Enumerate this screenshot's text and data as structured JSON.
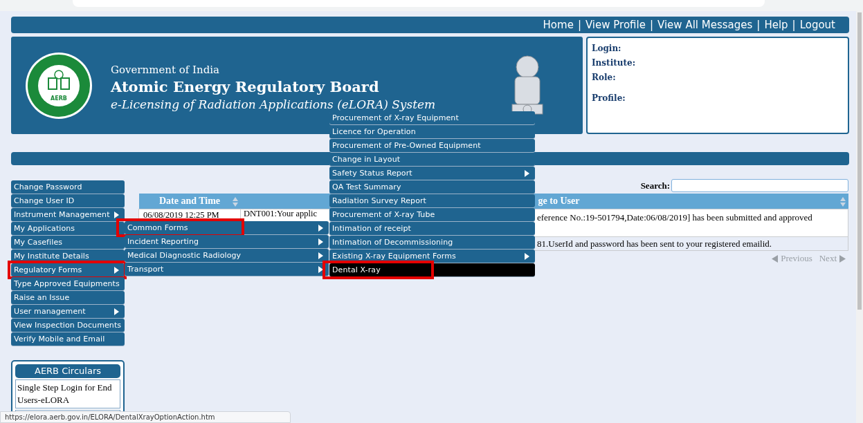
{
  "top_nav": {
    "links": [
      "Home",
      "View Profile",
      "View All Messages",
      "Help",
      "Logout"
    ],
    "separator": "|"
  },
  "banner": {
    "logo_text": "AERB",
    "line_1": "Government of India",
    "line_2": "Atomic Energy Regulatory Board",
    "line_3": "e-Licensing of Radiation Applications (eLORA) System"
  },
  "user_box": {
    "fields": [
      "Login:",
      "Institute:",
      "Role:",
      "Profile:"
    ]
  },
  "sidebar": {
    "items": [
      {
        "label": "Change Password",
        "has_submenu": false,
        "selected": false,
        "annotated": false
      },
      {
        "label": "Change User ID",
        "has_submenu": false,
        "selected": false,
        "annotated": false
      },
      {
        "label": "Instrument Management",
        "has_submenu": true,
        "selected": false,
        "annotated": false
      },
      {
        "label": "My Applications",
        "has_submenu": false,
        "selected": false,
        "annotated": false
      },
      {
        "label": "My Casefiles",
        "has_submenu": false,
        "selected": false,
        "annotated": false
      },
      {
        "label": "My Institute Details",
        "has_submenu": false,
        "selected": false,
        "annotated": false
      },
      {
        "label": "Regulatory Forms",
        "has_submenu": true,
        "selected": false,
        "annotated": true
      },
      {
        "label": "Type Approved Equipments",
        "has_submenu": false,
        "selected": false,
        "annotated": false
      },
      {
        "label": "Raise an Issue",
        "has_submenu": false,
        "selected": false,
        "annotated": false
      },
      {
        "label": "User management",
        "has_submenu": true,
        "selected": false,
        "annotated": false
      },
      {
        "label": "View Inspection Documents",
        "has_submenu": false,
        "selected": false,
        "annotated": false
      },
      {
        "label": "Verify Mobile and Email",
        "has_submenu": false,
        "selected": false,
        "annotated": false
      }
    ]
  },
  "submenu": {
    "items": [
      {
        "label": "Common Forms",
        "has_submenu": true,
        "selected": false,
        "annotated": true
      },
      {
        "label": "Incident Reporting",
        "has_submenu": true,
        "selected": false,
        "annotated": false
      },
      {
        "label": "Medical Diagnostic Radiology",
        "has_submenu": true,
        "selected": false,
        "annotated": false
      },
      {
        "label": "Transport",
        "has_submenu": true,
        "selected": false,
        "annotated": false
      }
    ]
  },
  "common_forms_menu": {
    "items": [
      {
        "label": "Procurement of X-ray Equipment",
        "has_submenu": false,
        "selected": false,
        "annotated": false
      },
      {
        "label": "Licence for Operation",
        "has_submenu": false,
        "selected": false,
        "annotated": false
      },
      {
        "label": "Procurement of Pre-Owned Equipment",
        "has_submenu": false,
        "selected": false,
        "annotated": false
      },
      {
        "label": "Change in Layout",
        "has_submenu": false,
        "selected": false,
        "annotated": false
      },
      {
        "label": "Safety Status Report",
        "has_submenu": true,
        "selected": false,
        "annotated": false
      },
      {
        "label": "QA Test Summary",
        "has_submenu": false,
        "selected": false,
        "annotated": false
      },
      {
        "label": "Radiation Survey Report",
        "has_submenu": false,
        "selected": false,
        "annotated": false
      },
      {
        "label": "Procurement of X-ray Tube",
        "has_submenu": false,
        "selected": false,
        "annotated": false
      },
      {
        "label": "Intimation of receipt",
        "has_submenu": false,
        "selected": false,
        "annotated": false
      },
      {
        "label": "Intimation of Decommissioning",
        "has_submenu": false,
        "selected": false,
        "annotated": false
      },
      {
        "label": "Existing X-ray Equipment Forms",
        "has_submenu": true,
        "selected": false,
        "annotated": false
      },
      {
        "label": "Dental X-ray",
        "has_submenu": false,
        "selected": true,
        "annotated": true
      }
    ]
  },
  "search": {
    "label": "Search:"
  },
  "table": {
    "columns": [
      "Date and Time",
      "ge to User"
    ],
    "rows": [
      {
        "date": "06/08/2019 12:25 PM",
        "message_start": "DNT001:Your applic",
        "message_end": "eference No.:19-501794,Date:06/08/2019] has been submitted and approved"
      },
      {
        "message_end": "81.UserId and password has been sent to your registered emailid."
      }
    ]
  },
  "pagination": {
    "previous": "Previous",
    "next": "Next",
    "disabled": true
  },
  "circulars": {
    "title": "AERB Circulars",
    "items": [
      "Single Step Login for End Users-eLORA"
    ]
  },
  "status_bar": {
    "url": "https://elora.aerb.gov.in/ELORA/DentalXrayOptionAction.htm"
  }
}
